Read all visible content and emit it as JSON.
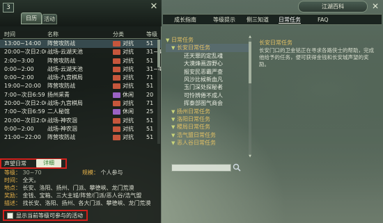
{
  "calendar": {
    "badge": "3",
    "close": "✕",
    "tabs": [
      "日历",
      "活动"
    ],
    "columns": {
      "time": "时间",
      "name": "名称",
      "category": "分类",
      "level": "等级"
    },
    "rows": [
      {
        "time": "13:00~14:00",
        "name": "阵营攻防战",
        "category": "对抗",
        "level": "51",
        "icon": "#c6563c"
      },
      {
        "time": "20:00~次日2:00",
        "name": "战场-云湖天池",
        "category": "对抗",
        "level": "31~4",
        "icon": "#c6563c"
      },
      {
        "time": "2:00~3:00",
        "name": "阵营攻防战",
        "category": "对抗",
        "level": "51",
        "icon": "#c6563c"
      },
      {
        "time": "0:00~2:00",
        "name": "战场-云湖天池",
        "category": "对抗",
        "level": "31~4",
        "icon": "#c6563c"
      },
      {
        "time": "0:00~2:00",
        "name": "战场-九宫棋局",
        "category": "对抗",
        "level": "71",
        "icon": "#c6563c"
      },
      {
        "time": "19:00~20:00",
        "name": "阵营攻防战",
        "category": "对抗",
        "level": "51",
        "icon": "#c6563c"
      },
      {
        "time": "7:00~次日6:59",
        "name": "扬州采青",
        "category": "休闲",
        "level": "20",
        "icon": "#9a62c4"
      },
      {
        "time": "20:00~次日2:00",
        "name": "战场-九宫棋局",
        "category": "对抗",
        "level": "71",
        "icon": "#c6563c"
      },
      {
        "time": "7:00~次日6:59",
        "name": "二人秘馆",
        "category": "休闲",
        "level": "25",
        "icon": "#9a62c4"
      },
      {
        "time": "20:00~次日2:00",
        "name": "战场-神农洇",
        "category": "对抗",
        "level": "51",
        "icon": "#c6563c"
      },
      {
        "time": "0:00~2:00",
        "name": "战场-神农洇",
        "category": "对抗",
        "level": "51",
        "icon": "#c6563c"
      },
      {
        "time": "21:00~22:00",
        "name": "阵营攻防战",
        "category": "对抗",
        "level": "51",
        "icon": "#c6563c"
      }
    ],
    "detail": {
      "tab_a": "声望日常",
      "tab_b": "详细",
      "level_key": "等级：",
      "level_val": "30~70",
      "mode_key": "规模：",
      "mode_val": "个人参与",
      "time_key": "时间：",
      "time_val": "全天。",
      "place_key": "地点：",
      "place_val": "长安、洛阳、扬州、门派、攀德峡、龙门荒漠",
      "reward_key": "奖励：",
      "reward_val": "金钱、宝箱、三大主城/阵营/门派/恶人谷/浩气盟",
      "desc_key": "描述：",
      "desc_val": "找长安、洛阳、扬州、各大门派、攀德峡、龙门荒漠"
    },
    "filter_label": "显示当前等级可参与的活动"
  },
  "encyclopedia": {
    "title": "江湖百科",
    "close": "✕",
    "nav": [
      "成长指南",
      "等级提示",
      "侧三知道",
      "日常任务",
      "FAQ"
    ],
    "active_nav": "日常任务",
    "tree": [
      {
        "kind": "cat",
        "label": "日常任务"
      },
      {
        "kind": "sub",
        "label": "长安日常任务"
      },
      {
        "kind": "leaf",
        "label": "还天罪的定乱魂"
      },
      {
        "kind": "leaf",
        "label": "大漠烽画游野心"
      },
      {
        "kind": "leaf",
        "label": "报安民恶霸严查"
      },
      {
        "kind": "leaf",
        "label": "风沙比候新血凡"
      },
      {
        "kind": "leaf",
        "label": "玉门深处探秘者"
      },
      {
        "kind": "leaf",
        "label": "可怜辨倦不成人"
      },
      {
        "kind": "leaf",
        "label": "挥泰部图气商会"
      },
      {
        "kind": "sub",
        "label": "扬州日常任务"
      },
      {
        "kind": "sub",
        "label": "洛阳日常任务"
      },
      {
        "kind": "sub",
        "label": "稷局日常任务"
      },
      {
        "kind": "sub",
        "label": "浩气盟日常任务"
      },
      {
        "kind": "sub",
        "label": "恶人谷日常任务"
      }
    ],
    "search_placeholder": "",
    "content_title": "长安日常任务",
    "content_body": "长安门口的卫金铭正在寻求各路侠士的帮助，完成他给予的任务，便可获得金钱和长安城声望的奖励。"
  }
}
